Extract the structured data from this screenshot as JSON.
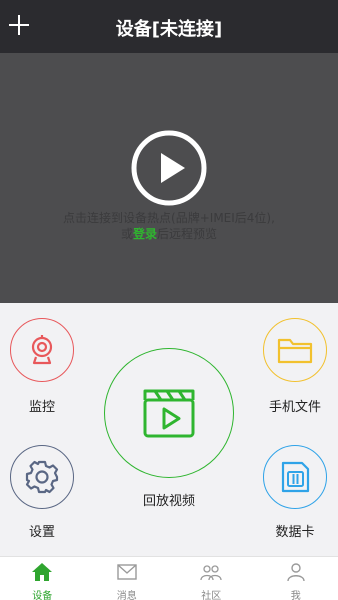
{
  "header": {
    "title": "设备[未连接]"
  },
  "video": {
    "hint_line1": "点击连接到设备热点(品牌+IMEI后4位),",
    "hint_prefix": "或",
    "login": "登录",
    "hint_suffix": "后远程预览"
  },
  "actions": {
    "monitor": "监控",
    "files": "手机文件",
    "playback": "回放视频",
    "settings": "设置",
    "sim_card": "数据卡"
  },
  "colors": {
    "monitor": "#e8585b",
    "files": "#f2c12e",
    "playback": "#2fb52f",
    "settings": "#5a6784",
    "sim_card": "#2fa3e8"
  },
  "tabs": [
    {
      "label": "设备",
      "icon": "home-icon",
      "active": true
    },
    {
      "label": "消息",
      "icon": "mail-icon",
      "active": false
    },
    {
      "label": "社区",
      "icon": "people-icon",
      "active": false
    },
    {
      "label": "我",
      "icon": "person-icon",
      "active": false
    }
  ]
}
